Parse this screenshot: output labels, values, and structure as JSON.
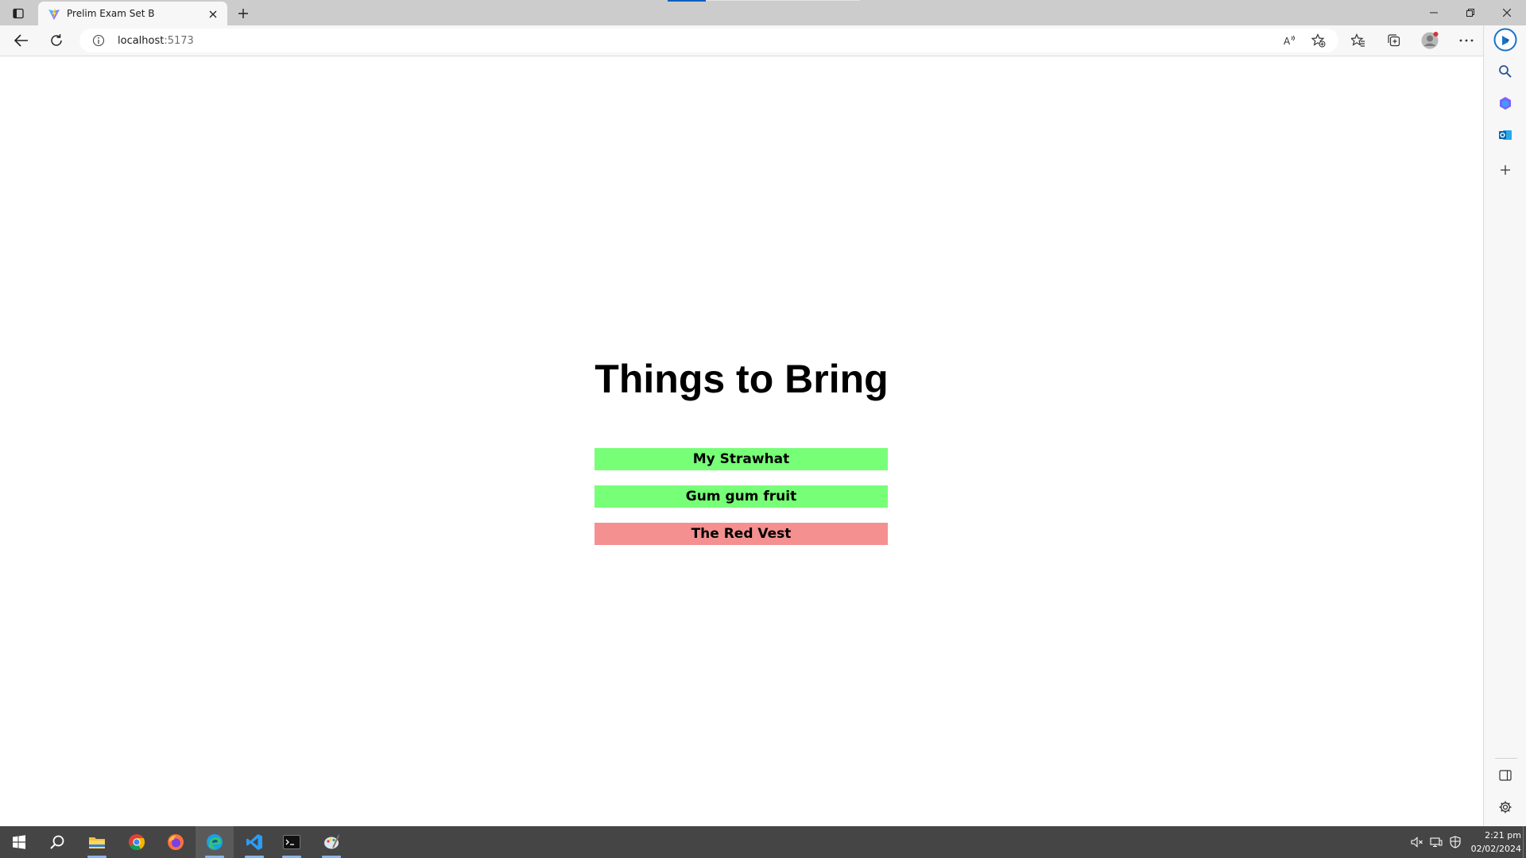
{
  "browser": {
    "tab": {
      "title": "Prelim Exam Set B"
    },
    "address": {
      "host": "localhost",
      "port": ":5173"
    }
  },
  "page": {
    "title": "Things to Bring",
    "items": [
      {
        "label": "My Strawhat",
        "status_color": "#77ff77"
      },
      {
        "label": "Gum gum fruit",
        "status_color": "#77ff77"
      },
      {
        "label": "The Red Vest",
        "status_color": "#f59090"
      }
    ]
  },
  "taskbar": {
    "apps": [
      "windows-start",
      "search",
      "file-explorer",
      "chrome",
      "firefox",
      "edge",
      "vscode",
      "terminal",
      "paint"
    ],
    "clock": {
      "time": "2:21 pm",
      "date": "02/02/2024"
    }
  }
}
